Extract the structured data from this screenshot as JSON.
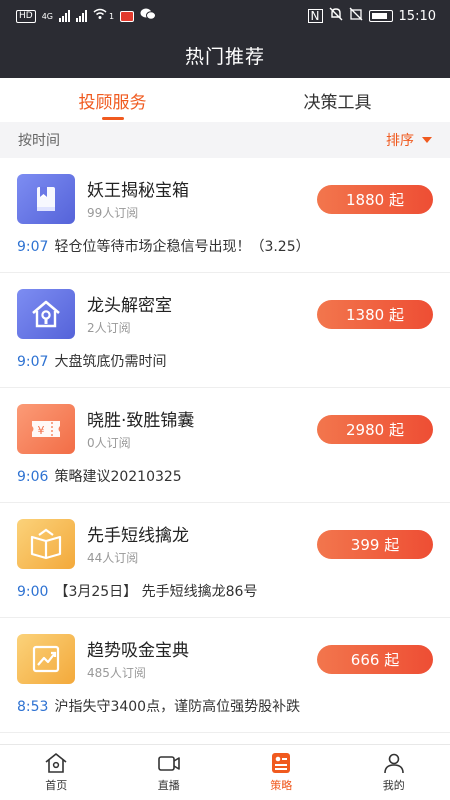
{
  "status_bar": {
    "left_tags": [
      "HD",
      "4G",
      "1"
    ],
    "time": "15:10",
    "nfc": "N"
  },
  "header": {
    "title": "热门推荐"
  },
  "tabs": [
    {
      "label": "投顾服务",
      "active": true
    },
    {
      "label": "决策工具",
      "active": false
    }
  ],
  "filter": {
    "left_label": "按时间",
    "sort_label": "排序"
  },
  "items": [
    {
      "icon": "book-icon",
      "color": "blue",
      "name": "妖王揭秘宝箱",
      "subscribers": "99人订阅",
      "price": "1880 起",
      "news_time": "9:07",
      "news_text": "轻仓位等待市场企稳信号出现！（3.25）"
    },
    {
      "icon": "house-icon",
      "color": "blue",
      "name": "龙头解密室",
      "subscribers": "2人订阅",
      "price": "1380 起",
      "news_time": "9:07",
      "news_text": "大盘筑底仍需时间"
    },
    {
      "icon": "ticket-icon",
      "color": "orange",
      "name": "晓胜·致胜锦囊",
      "subscribers": "0人订阅",
      "price": "2980 起",
      "news_time": "9:06",
      "news_text": "策略建议20210325"
    },
    {
      "icon": "open-book-icon",
      "color": "yellow",
      "name": "先手短线擒龙",
      "subscribers": "44人订阅",
      "price": "399 起",
      "news_time": "9:00",
      "news_text": "【3月25日】 先手短线擒龙86号"
    },
    {
      "icon": "trend-chart-icon",
      "color": "yellow",
      "name": "趋势吸金宝典",
      "subscribers": "485人订阅",
      "price": "666 起",
      "news_time": "8:53",
      "news_text": "沪指失守3400点，谨防高位强势股补跌"
    }
  ],
  "bottom_nav": [
    {
      "label": "首页",
      "icon": "home-icon",
      "active": false
    },
    {
      "label": "直播",
      "icon": "video-icon",
      "active": false
    },
    {
      "label": "策略",
      "icon": "strategy-icon",
      "active": true
    },
    {
      "label": "我的",
      "icon": "user-icon",
      "active": false
    }
  ],
  "colors": {
    "accent": "#f05a1f",
    "header_bg": "#2b2c33",
    "time_blue": "#2e72d2"
  }
}
